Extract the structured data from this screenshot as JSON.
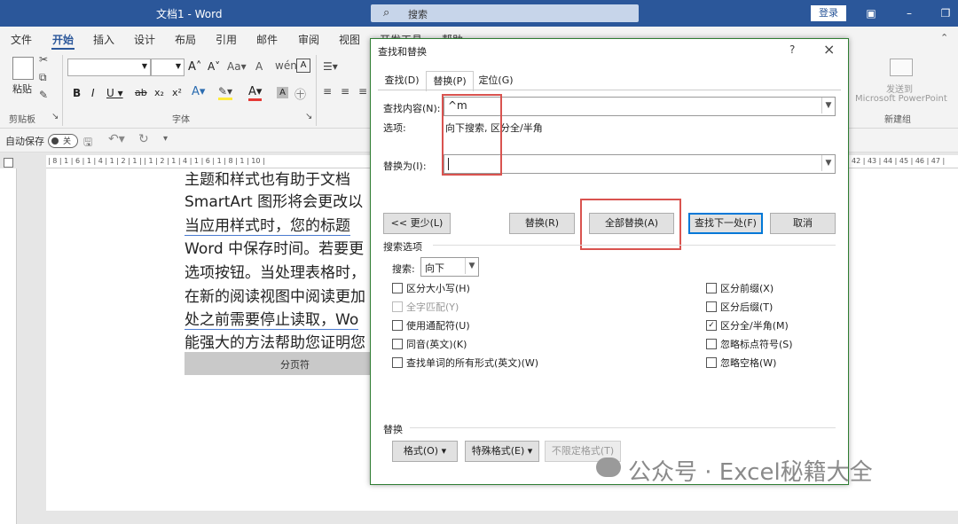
{
  "titlebar": {
    "doc_title": "文档1  -  Word",
    "search_label": "搜索",
    "login_label": "登录"
  },
  "ribbon_tabs": [
    "文件",
    "开始",
    "插入",
    "设计",
    "布局",
    "引用",
    "邮件",
    "审阅",
    "视图",
    "开发工具",
    "帮助"
  ],
  "ribbon": {
    "paste_label": "粘贴",
    "clipboard_label": "剪贴板",
    "font_group_label": "字体",
    "send_to_label": "发送到",
    "send_to_sub": "Microsoft PowerPoint",
    "new_group_label": "新建组"
  },
  "qat": {
    "autosave_label": "自动保存",
    "toggle_state": "关"
  },
  "ruler_text": "| 8 | 1 | 6 | 1 | 4 | 1 | 2 | 1 |   | 1 | 2 | 1 | 4 | 1 | 6 | 1 | 8 | 1 | 10 |",
  "ruler_right": "42 | 43 | 44 | 45 | 46 | 47 |",
  "document": {
    "lines": [
      "主题和样式也有助于文档",
      "SmartArt 图形将会更改以",
      "当应用样式时，您的标题",
      "Word 中保存时间。若要更",
      "选项按钮。当处理表格时，",
      "在新的阅读视图中阅读更加",
      "处之前需要停止读取，Wo",
      "能强大的方法帮助您证明您"
    ],
    "page_break_label": "分页符"
  },
  "dialog": {
    "title": "查找和替换",
    "help": "?",
    "close": "×",
    "tabs": [
      "查找(D)",
      "替换(P)",
      "定位(G)"
    ],
    "find_label": "查找内容(N):",
    "find_value": "^m",
    "options_label": "选项:",
    "options_value": "向下搜索, 区分全/半角",
    "replace_label": "替换为(I):",
    "replace_value": "",
    "buttons": {
      "less": "<< 更少(L)",
      "replace": "替换(R)",
      "replace_all": "全部替换(A)",
      "find_next": "查找下一处(F)",
      "cancel": "取消"
    },
    "search_options_label": "搜索选项",
    "search_label": "搜索:",
    "search_direction": "向下",
    "checkboxes_left": [
      {
        "label": "区分大小写(H)",
        "checked": false,
        "disabled": false
      },
      {
        "label": "全字匹配(Y)",
        "checked": false,
        "disabled": true
      },
      {
        "label": "使用通配符(U)",
        "checked": false,
        "disabled": false
      },
      {
        "label": "同音(英文)(K)",
        "checked": false,
        "disabled": false
      },
      {
        "label": "查找单词的所有形式(英文)(W)",
        "checked": false,
        "disabled": false
      }
    ],
    "checkboxes_right": [
      {
        "label": "区分前缀(X)",
        "checked": false,
        "disabled": false
      },
      {
        "label": "区分后缀(T)",
        "checked": false,
        "disabled": false
      },
      {
        "label": "区分全/半角(M)",
        "checked": true,
        "disabled": false
      },
      {
        "label": "忽略标点符号(S)",
        "checked": false,
        "disabled": false
      },
      {
        "label": "忽略空格(W)",
        "checked": false,
        "disabled": false
      }
    ],
    "replace_section_label": "替换",
    "bottom_buttons": {
      "format": "格式(O) ▾",
      "special": "特殊格式(E) ▾",
      "no_format": "不限定格式(T)"
    }
  },
  "watermark": "公众号 · Excel秘籍大全"
}
